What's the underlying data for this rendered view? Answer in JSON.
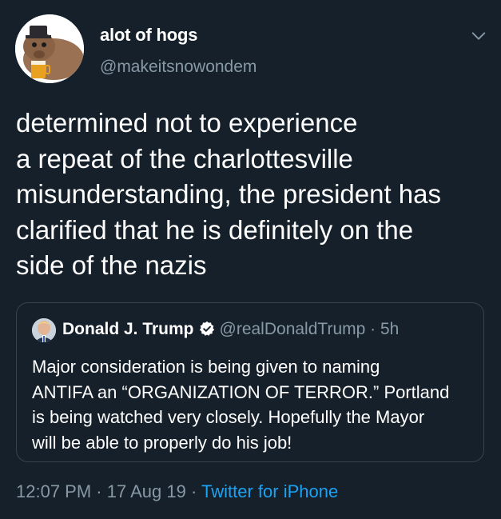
{
  "author": {
    "display_name": "alot of hogs",
    "handle": "@makeitsnowondem"
  },
  "tweet": {
    "text_lines": [
      "determined not to experience",
      "a repeat of the charlottesville",
      "misunderstanding, the president has",
      "clarified that he is definitely on the",
      "side of the nazis"
    ]
  },
  "quoted_tweet": {
    "display_name": "Donald J. Trump",
    "handle": "@realDonaldTrump",
    "separator": "·",
    "time_ago": "5h",
    "body_lines": [
      "Major consideration is being given to naming",
      "ANTIFA an “ORGANIZATION OF TERROR.” Portland",
      "is being watched very closely. Hopefully the Mayor",
      "will be able to properly do his job!"
    ]
  },
  "meta": {
    "time": "12:07 PM",
    "sep1": "·",
    "date": "17 Aug 19",
    "sep2": "·",
    "source": "Twitter for iPhone"
  },
  "icons": {
    "chevron": "chevron-down-icon",
    "verified": "verified-badge-icon"
  },
  "colors": {
    "background": "#15202b",
    "secondary_text": "#8899a6",
    "link": "#1da1f2",
    "border": "#38444d"
  }
}
